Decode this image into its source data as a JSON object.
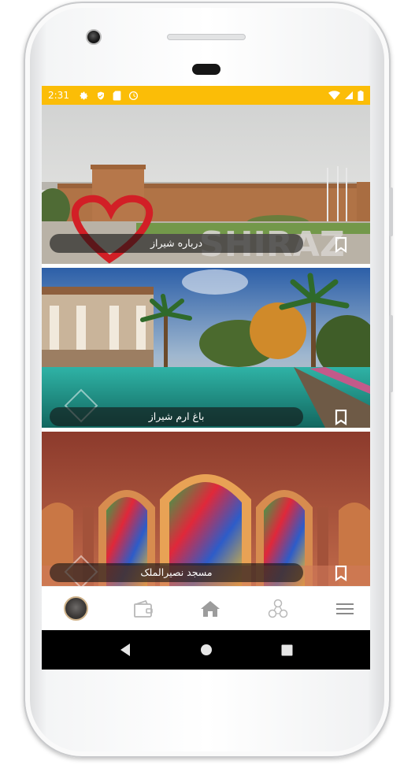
{
  "status_bar": {
    "time": "2:31",
    "background": "#fbbd07",
    "left_icons": [
      "gear-icon",
      "shield-icon",
      "sd-card-icon",
      "sync-icon"
    ],
    "right_icons": [
      "wifi-icon",
      "cell-signal-icon",
      "battery-icon"
    ]
  },
  "cards": [
    {
      "title": "درباره شیراز",
      "image": "karim-khan-citadel-photo",
      "action_icon": "bookmark-icon"
    },
    {
      "title": "باغ ارم شیراز",
      "image": "eram-garden-photo",
      "action_icon": "bookmark-icon"
    },
    {
      "title": "مسجد نصیرالملک",
      "image": "nasir-ol-molk-mosque-photo",
      "action_icon": "bookmark-icon"
    }
  ],
  "bottom_nav": {
    "items": [
      "profile-avatar",
      "wallet-icon",
      "home-icon",
      "network-icon",
      "menu-icon"
    ]
  },
  "system_nav": {
    "items": [
      "back-icon",
      "home-circle-icon",
      "recents-icon"
    ]
  }
}
